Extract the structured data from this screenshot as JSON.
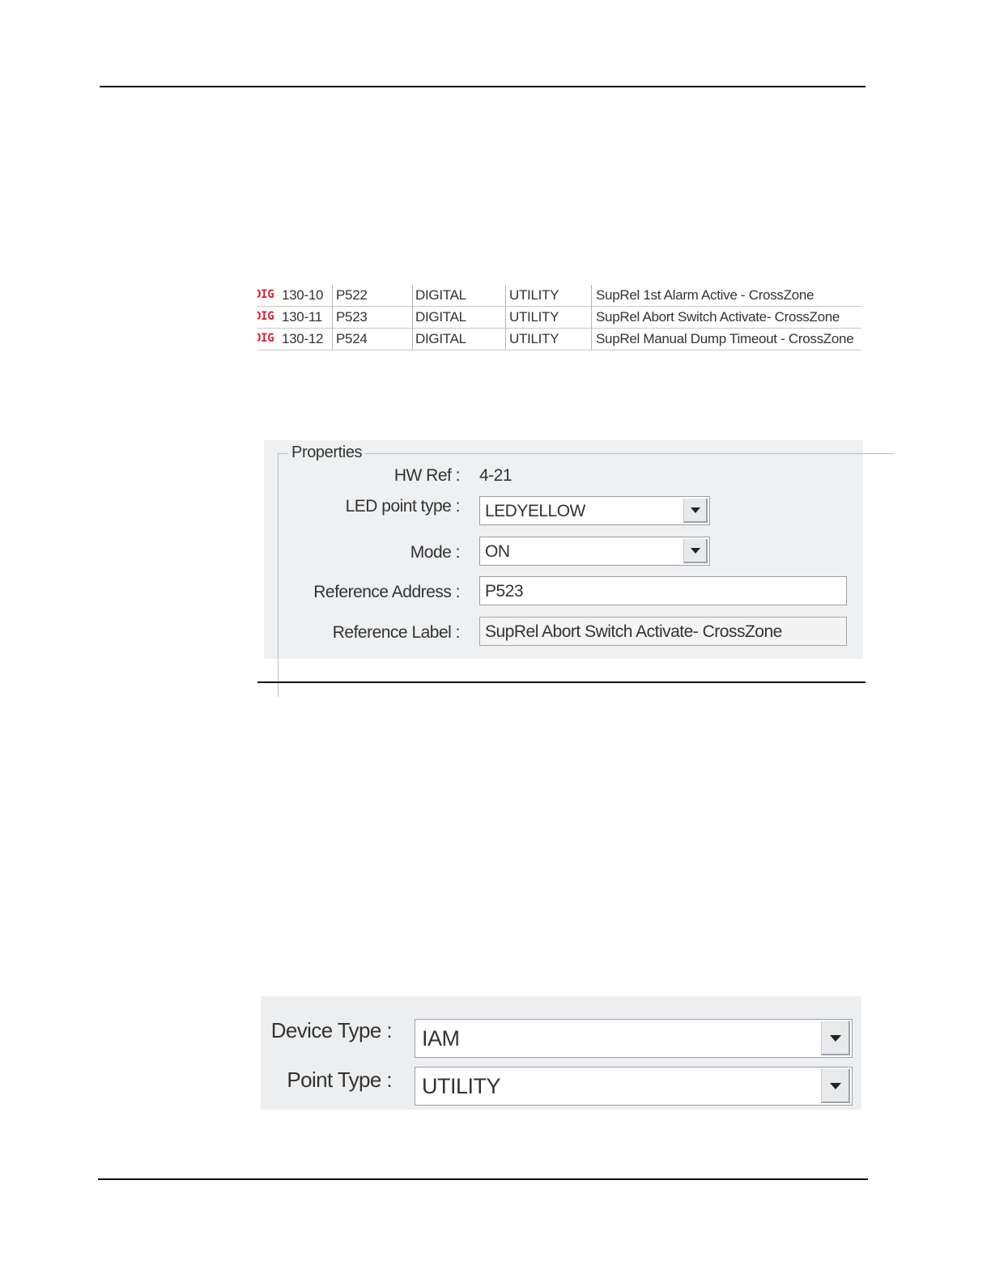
{
  "points_table": {
    "rows": [
      {
        "tag": "DIG",
        "address": "130-10",
        "reference": "P522",
        "type": "DIGITAL",
        "class": "UTILITY",
        "label": "SupRel 1st Alarm Active - CrossZone"
      },
      {
        "tag": "DIG",
        "address": "130-11",
        "reference": "P523",
        "type": "DIGITAL",
        "class": "UTILITY",
        "label": "SupRel Abort Switch Activate- CrossZone"
      },
      {
        "tag": "DIG",
        "address": "130-12",
        "reference": "P524",
        "type": "DIGITAL",
        "class": "UTILITY",
        "label": "SupRel Manual Dump Timeout - CrossZone"
      }
    ]
  },
  "properties": {
    "group_title": "Properties",
    "hw_ref_label": "HW Ref :",
    "hw_ref_value": "4-21",
    "led_point_type_label": "LED point type :",
    "led_point_type_value": "LEDYELLOW",
    "mode_label": "Mode :",
    "mode_value": "ON",
    "reference_address_label": "Reference Address :",
    "reference_address_value": "P523",
    "reference_label_label": "Reference Label :",
    "reference_label_value": "SupRel Abort Switch Activate- CrossZone"
  },
  "device": {
    "device_type_label": "Device Type :",
    "device_type_value": "IAM",
    "point_type_label": "Point Type :",
    "point_type_value": "UTILITY"
  },
  "icons": {
    "dropdown": "chevron-down-icon"
  }
}
